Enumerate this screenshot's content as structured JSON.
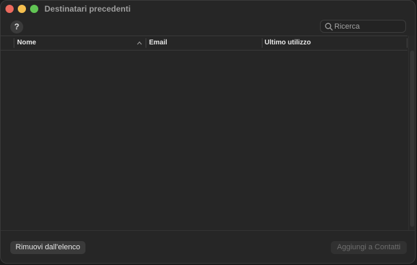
{
  "window": {
    "title": "Destinatari precedenti"
  },
  "toolbar": {
    "help_label": "?",
    "search_placeholder": "Ricerca",
    "search_value": ""
  },
  "table": {
    "columns": [
      {
        "label": "Nome",
        "sorted": "ascending"
      },
      {
        "label": "Email"
      },
      {
        "label": "Ultimo utilizzo"
      }
    ],
    "rows": []
  },
  "footer": {
    "remove_label": "Rimuovi dall'elenco",
    "add_label": "Aggiungi a Contatti",
    "add_enabled": false
  },
  "colors": {
    "close": "#ed6a5e",
    "minimize": "#f5bf4f",
    "zoom": "#61c554",
    "window_bg": "#262626"
  }
}
